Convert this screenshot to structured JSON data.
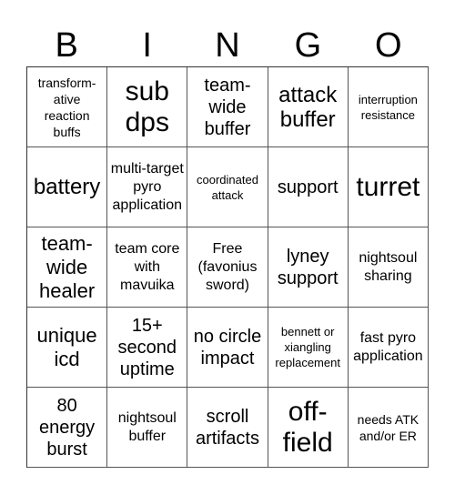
{
  "header": {
    "letters": [
      "B",
      "I",
      "N",
      "G",
      "O"
    ]
  },
  "cells": [
    [
      "transform-ative reaction buffs",
      "sub dps",
      "team-wide buffer",
      "attack buffer",
      "interruption resistance"
    ],
    [
      "battery",
      "multi-target pyro application",
      "coordinated attack",
      "support",
      "turret"
    ],
    [
      "team-wide healer",
      "team core with mavuika",
      "Free (favonius sword)",
      "lyney support",
      "nightsoul sharing"
    ],
    [
      "unique icd",
      "15+ second uptime",
      "no circle impact",
      "bennett or xiangling replacement",
      "fast pyro application"
    ],
    [
      "80 energy burst",
      "nightsoul buffer",
      "scroll artifacts",
      "off-field",
      "needs ATK and/or ER"
    ]
  ]
}
